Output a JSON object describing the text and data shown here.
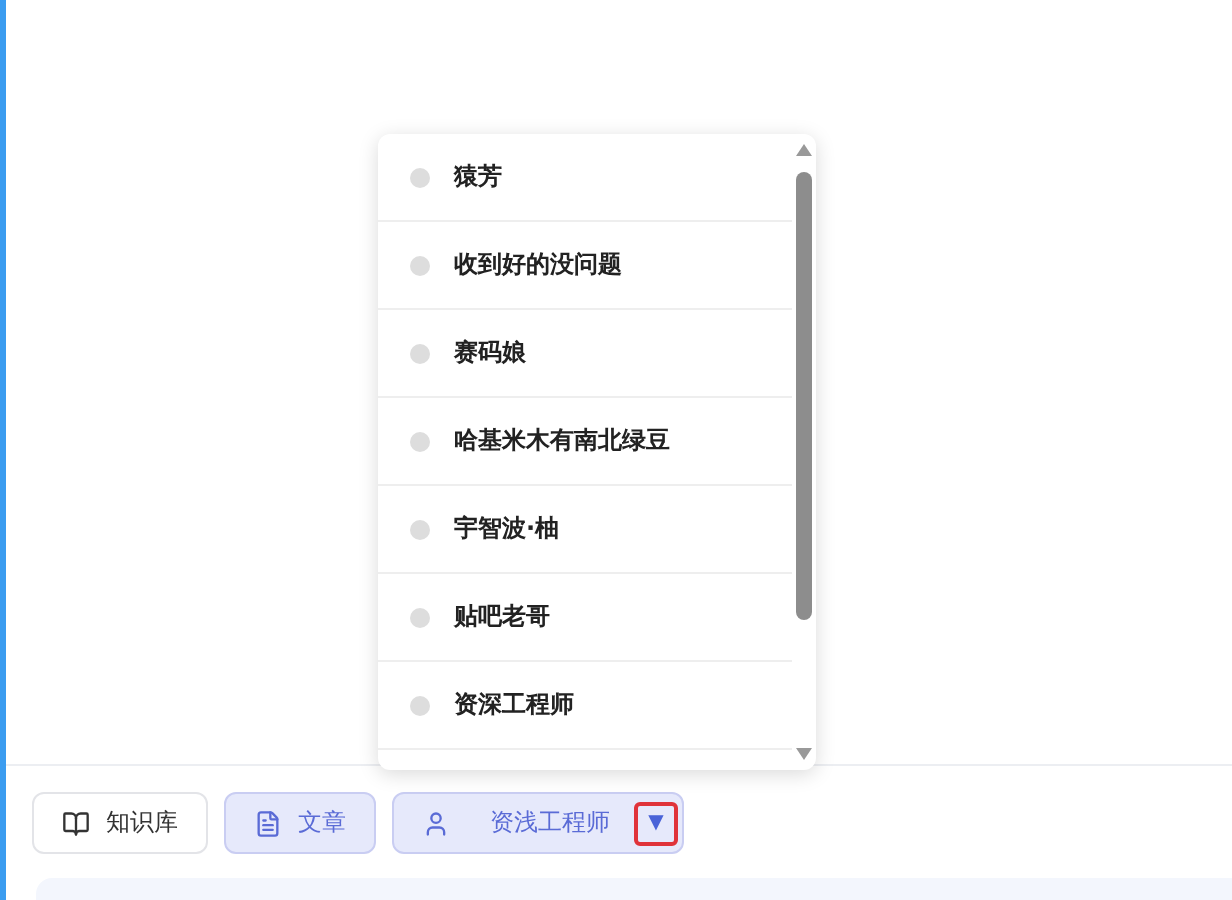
{
  "dropdown": {
    "items": [
      {
        "label": "猿芳"
      },
      {
        "label": "收到好的没问题"
      },
      {
        "label": "赛码娘"
      },
      {
        "label": "哈基米木有南北绿豆"
      },
      {
        "label": "宇智波·柚"
      },
      {
        "label": "贴吧老哥"
      },
      {
        "label": "资深工程师"
      }
    ]
  },
  "toolbar": {
    "buttons": [
      {
        "kind": "knowledge",
        "label": "知识库",
        "selected": false
      },
      {
        "kind": "article",
        "label": "文章",
        "selected": true
      },
      {
        "kind": "persona",
        "label": "资浅工程师",
        "selected": true,
        "caret": "▼"
      }
    ]
  }
}
